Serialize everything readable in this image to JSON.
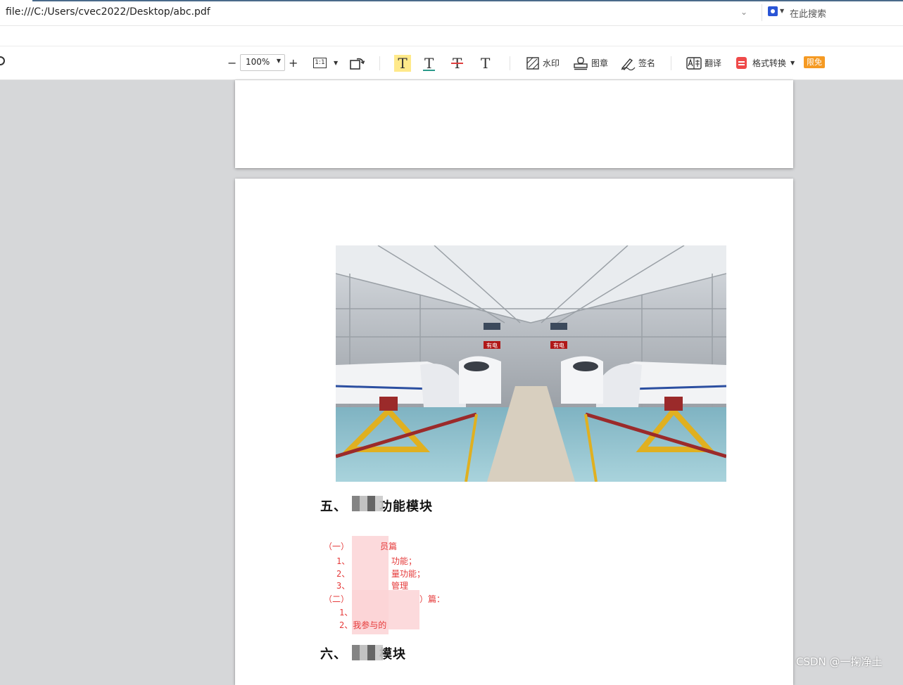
{
  "browser": {
    "url": "file:///C:/Users/cvec2022/Desktop/abc.pdf",
    "search_placeholder": "在此搜索"
  },
  "toolbar": {
    "zoom_out": "−",
    "zoom_value": "100%",
    "zoom_in": "+",
    "actual_size": "1:1",
    "watermark_label": "水印",
    "stamp_label": "图章",
    "sign_label": "签名",
    "translate_label": "翻译",
    "convert_label": "格式转换",
    "promo_badge": "限免",
    "colors": {
      "highlight": "#ffe98a",
      "underline": "#2b9a8a",
      "strike": "#e04040",
      "convert": "#ef4a4a",
      "promo": "#f59a23"
    },
    "icons": [
      "search-icon",
      "rotate-icon",
      "highlight-text-icon",
      "underline-text-icon",
      "strikethrough-text-icon",
      "text-icon",
      "watermark-icon",
      "stamp-icon",
      "signature-icon",
      "translate-icon",
      "convert-icon"
    ]
  },
  "document": {
    "image_alt": "high-speed trains in maintenance depot",
    "sign_left": "有电",
    "sign_right": "有电",
    "section5_prefix": "五、",
    "section5_suffix": "功能模块",
    "list": [
      "（一）",
      "1、",
      "2、",
      "3、",
      "（二）",
      "1、",
      "2、我参与的"
    ],
    "list_tails": [
      "员篇",
      "功能；",
      "量功能；",
      "管理",
      "）篇："
    ],
    "section6_prefix": "六、",
    "section6_suffix": "模块"
  },
  "watermark": "CSDN @一掬净土"
}
